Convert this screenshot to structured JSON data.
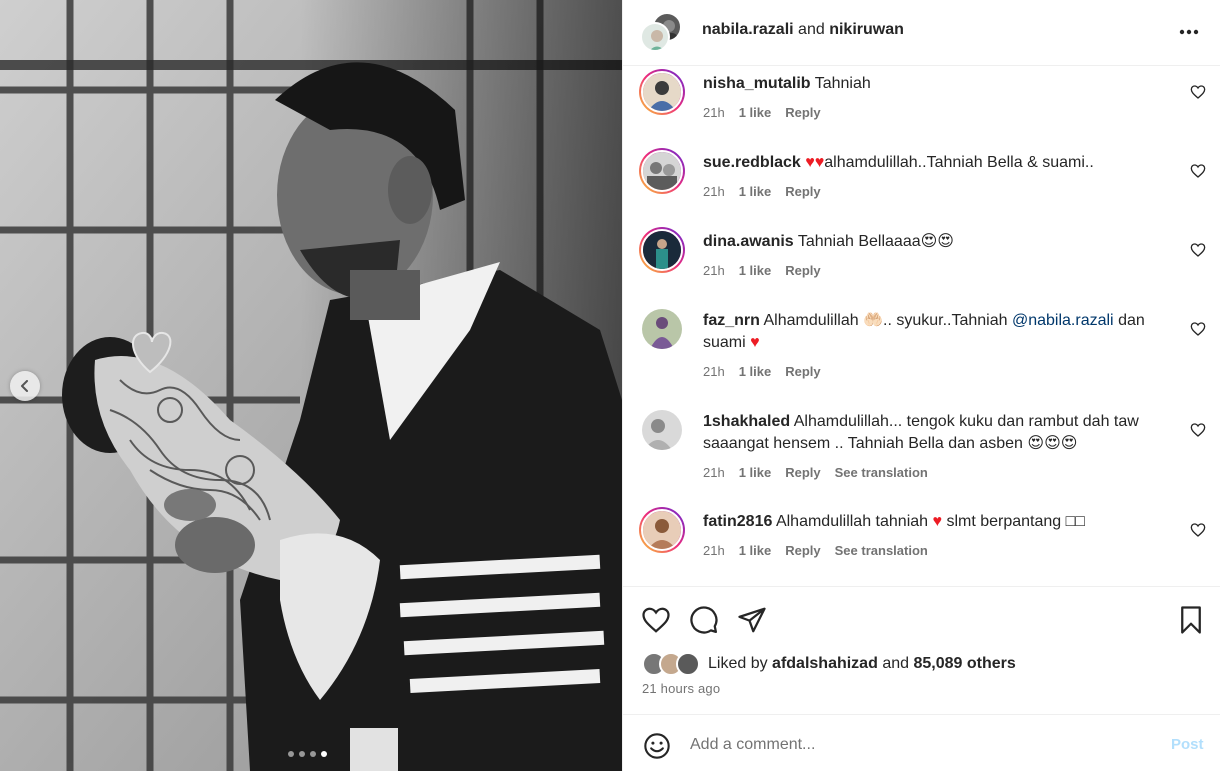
{
  "post": {
    "header": {
      "author_1": "nabila.razali",
      "joiner": "and",
      "author_2": "nikiruwan"
    },
    "carousel": {
      "slide_count": 4,
      "active_index": 3
    }
  },
  "comments": [
    {
      "user": "nisha_mutalib",
      "text": "Tahniah",
      "time": "21h",
      "likes": "1 like",
      "reply": "Reply"
    },
    {
      "user": "sue.redblack",
      "text_after": "alhamdulillah..Tahniah Bella & suami..",
      "time": "21h",
      "likes": "1 like",
      "reply": "Reply"
    },
    {
      "user": "dina.awanis",
      "text": "Tahniah Bellaaaa",
      "time": "21h",
      "likes": "1 like",
      "reply": "Reply"
    },
    {
      "user": "faz_nrn",
      "text_a": "Alhamdulillah",
      "text_b": ".. syukur..Tahniah",
      "mention": "@nabila.razali",
      "text_c": "dan",
      "text_d": "suami",
      "time": "21h",
      "likes": "1 like",
      "reply": "Reply"
    },
    {
      "user": "1shakhaled",
      "text_line1": "Alhamdulillah... tengok kuku dan rambut dah taw",
      "text_line2": "saaangat hensem .. Tahniah Bella dan asben",
      "time": "21h",
      "likes": "1 like",
      "reply": "Reply",
      "translate": "See translation"
    },
    {
      "user": "fatin2816",
      "text_a": "Alhamdulillah tahniah",
      "text_b": "slmt berpantang",
      "time": "21h",
      "likes": "1 like",
      "reply": "Reply",
      "translate": "See translation"
    }
  ],
  "engagement": {
    "liked_by_prefix": "Liked by",
    "liked_by_user": "afdalshahizad",
    "liked_by_and": "and",
    "liked_by_others": "85,089 others",
    "timestamp": "21 hours ago"
  },
  "composer": {
    "placeholder": "Add a comment...",
    "post_label": "Post"
  },
  "icons": {
    "heart": "heart-icon",
    "comment": "comment-icon",
    "share": "share-icon",
    "save": "bookmark-icon",
    "more": "more-icon",
    "emoji": "emoji-icon",
    "prev": "chevron-left-icon"
  },
  "colors": {
    "mention": "#00376b",
    "post_disabled": "#b2dffc",
    "heart_red": "#ed1c24",
    "muted": "#737373"
  }
}
